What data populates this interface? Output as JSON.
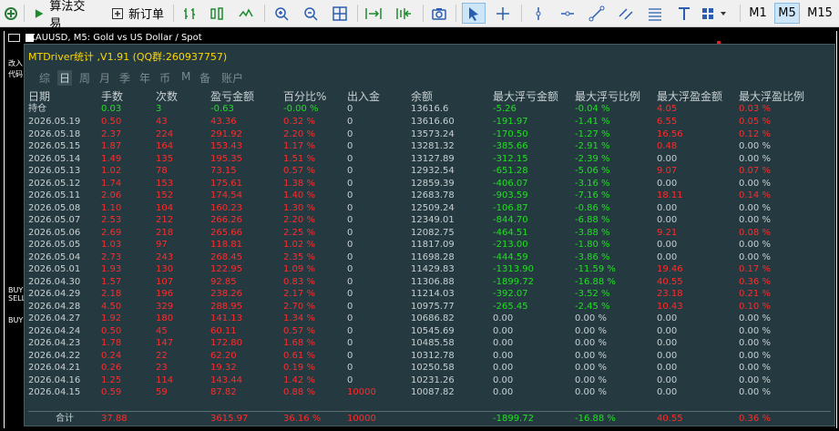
{
  "toolbar": {
    "algo_trading": "算法交易",
    "new_order": "新订单",
    "timeframes": [
      "M1",
      "M5",
      "M15"
    ]
  },
  "chart": {
    "title": "XAUUSD, M5:  Gold vs US Dollar / Spot",
    "side_labels": [
      "改入",
      "代码",
      "BUY",
      "SELL",
      "BUY"
    ]
  },
  "panel": {
    "title": "MTDriver统计 ,V1.91 (QQ群:260937757)",
    "tabs": [
      "综",
      "日",
      "周",
      "月",
      "季",
      "年",
      "币",
      "M",
      "备",
      "账户"
    ],
    "active_tab_index": 1,
    "columns": [
      "日期",
      "手数",
      "次数",
      "盈亏金额",
      "百分比%",
      "出入金",
      "余额",
      "最大浮亏金额",
      "最大浮亏比例",
      "最大浮盈金额",
      "最大浮盈比例"
    ],
    "holding": {
      "label": "持仓",
      "lots": "0.03",
      "count": "3",
      "pnl": "-0.63",
      "pct": "-0.00 %",
      "inout": "0",
      "balance": "13616.6",
      "max_float_loss": "-5.26",
      "max_float_loss_pct": "-0.04 %",
      "max_float_profit": "4.05",
      "max_float_profit_pct": "0.03 %"
    },
    "rows": [
      {
        "date": "2026.05.19",
        "lots": "0.50",
        "count": "43",
        "pnl": "43.36",
        "pct": "0.32 %",
        "inout": "0",
        "balance": "13616.60",
        "mfl": "-191.97",
        "mflp": "-1.41 %",
        "mfp": "6.55",
        "mfpp": "0.05 %"
      },
      {
        "date": "2026.05.18",
        "lots": "2.37",
        "count": "224",
        "pnl": "291.92",
        "pct": "2.20 %",
        "inout": "0",
        "balance": "13573.24",
        "mfl": "-170.50",
        "mflp": "-1.27 %",
        "mfp": "16.56",
        "mfpp": "0.12 %"
      },
      {
        "date": "2026.05.15",
        "lots": "1.87",
        "count": "164",
        "pnl": "153.43",
        "pct": "1.17 %",
        "inout": "0",
        "balance": "13281.32",
        "mfl": "-385.66",
        "mflp": "-2.91 %",
        "mfp": "0.48",
        "mfpp": "0.00 %"
      },
      {
        "date": "2026.05.14",
        "lots": "1.49",
        "count": "135",
        "pnl": "195.35",
        "pct": "1.51 %",
        "inout": "0",
        "balance": "13127.89",
        "mfl": "-312.15",
        "mflp": "-2.39 %",
        "mfp": "0.00",
        "mfpp": "0.00 %"
      },
      {
        "date": "2026.05.13",
        "lots": "1.02",
        "count": "78",
        "pnl": "73.15",
        "pct": "0.57 %",
        "inout": "0",
        "balance": "12932.54",
        "mfl": "-651.28",
        "mflp": "-5.06 %",
        "mfp": "9.07",
        "mfpp": "0.07 %"
      },
      {
        "date": "2026.05.12",
        "lots": "1.74",
        "count": "153",
        "pnl": "175.61",
        "pct": "1.38 %",
        "inout": "0",
        "balance": "12859.39",
        "mfl": "-406.07",
        "mflp": "-3.16 %",
        "mfp": "0.00",
        "mfpp": "0.00 %"
      },
      {
        "date": "2026.05.11",
        "lots": "2.06",
        "count": "152",
        "pnl": "174.54",
        "pct": "1.40 %",
        "inout": "0",
        "balance": "12683.78",
        "mfl": "-903.59",
        "mflp": "-7.16 %",
        "mfp": "18.11",
        "mfpp": "0.14 %"
      },
      {
        "date": "2026.05.08",
        "lots": "1.10",
        "count": "104",
        "pnl": "160.23",
        "pct": "1.30 %",
        "inout": "0",
        "balance": "12509.24",
        "mfl": "-106.87",
        "mflp": "-0.86 %",
        "mfp": "0.00",
        "mfpp": "0.00 %"
      },
      {
        "date": "2026.05.07",
        "lots": "2.53",
        "count": "212",
        "pnl": "266.26",
        "pct": "2.20 %",
        "inout": "0",
        "balance": "12349.01",
        "mfl": "-844.70",
        "mflp": "-6.88 %",
        "mfp": "0.00",
        "mfpp": "0.00 %"
      },
      {
        "date": "2026.05.06",
        "lots": "2.69",
        "count": "218",
        "pnl": "265.66",
        "pct": "2.25 %",
        "inout": "0",
        "balance": "12082.75",
        "mfl": "-464.51",
        "mflp": "-3.88 %",
        "mfp": "9.21",
        "mfpp": "0.08 %"
      },
      {
        "date": "2026.05.05",
        "lots": "1.03",
        "count": "97",
        "pnl": "118.81",
        "pct": "1.02 %",
        "inout": "0",
        "balance": "11817.09",
        "mfl": "-213.00",
        "mflp": "-1.80 %",
        "mfp": "0.00",
        "mfpp": "0.00 %"
      },
      {
        "date": "2026.05.04",
        "lots": "2.73",
        "count": "243",
        "pnl": "268.45",
        "pct": "2.35 %",
        "inout": "0",
        "balance": "11698.28",
        "mfl": "-444.59",
        "mflp": "-3.86 %",
        "mfp": "0.00",
        "mfpp": "0.00 %"
      },
      {
        "date": "2026.05.01",
        "lots": "1.93",
        "count": "130",
        "pnl": "122.95",
        "pct": "1.09 %",
        "inout": "0",
        "balance": "11429.83",
        "mfl": "-1313.90",
        "mflp": "-11.59 %",
        "mfp": "19.46",
        "mfpp": "0.17 %"
      },
      {
        "date": "2026.04.30",
        "lots": "1.57",
        "count": "107",
        "pnl": "92.85",
        "pct": "0.83 %",
        "inout": "0",
        "balance": "11306.88",
        "mfl": "-1899.72",
        "mflp": "-16.88 %",
        "mfp": "40.55",
        "mfpp": "0.36 %"
      },
      {
        "date": "2026.04.29",
        "lots": "2.18",
        "count": "196",
        "pnl": "238.26",
        "pct": "2.17 %",
        "inout": "0",
        "balance": "11214.03",
        "mfl": "-392.07",
        "mflp": "-3.52 %",
        "mfp": "23.18",
        "mfpp": "0.21 %"
      },
      {
        "date": "2026.04.28",
        "lots": "4.50",
        "count": "329",
        "pnl": "288.95",
        "pct": "2.70 %",
        "inout": "0",
        "balance": "10975.77",
        "mfl": "-265.45",
        "mflp": "-2.45 %",
        "mfp": "10.43",
        "mfpp": "0.10 %"
      },
      {
        "date": "2026.04.27",
        "lots": "1.92",
        "count": "180",
        "pnl": "141.13",
        "pct": "1.34 %",
        "inout": "0",
        "balance": "10686.82",
        "mfl": "0.00",
        "mflp": "0.00 %",
        "mfp": "0.00",
        "mfpp": "0.00 %"
      },
      {
        "date": "2026.04.24",
        "lots": "0.50",
        "count": "45",
        "pnl": "60.11",
        "pct": "0.57 %",
        "inout": "0",
        "balance": "10545.69",
        "mfl": "0.00",
        "mflp": "0.00 %",
        "mfp": "0.00",
        "mfpp": "0.00 %"
      },
      {
        "date": "2026.04.23",
        "lots": "1.78",
        "count": "147",
        "pnl": "172.80",
        "pct": "1.68 %",
        "inout": "0",
        "balance": "10485.58",
        "mfl": "0.00",
        "mflp": "0.00 %",
        "mfp": "0.00",
        "mfpp": "0.00 %"
      },
      {
        "date": "2026.04.22",
        "lots": "0.24",
        "count": "22",
        "pnl": "62.20",
        "pct": "0.61 %",
        "inout": "0",
        "balance": "10312.78",
        "mfl": "0.00",
        "mflp": "0.00 %",
        "mfp": "0.00",
        "mfpp": "0.00 %"
      },
      {
        "date": "2026.04.21",
        "lots": "0.26",
        "count": "23",
        "pnl": "19.32",
        "pct": "0.19 %",
        "inout": "0",
        "balance": "10250.58",
        "mfl": "0.00",
        "mflp": "0.00 %",
        "mfp": "0.00",
        "mfpp": "0.00 %"
      },
      {
        "date": "2026.04.16",
        "lots": "1.25",
        "count": "114",
        "pnl": "143.44",
        "pct": "1.42 %",
        "inout": "0",
        "balance": "10231.26",
        "mfl": "0.00",
        "mflp": "0.00 %",
        "mfp": "0.00",
        "mfpp": "0.00 %"
      },
      {
        "date": "2026.04.15",
        "lots": "0.59",
        "count": "59",
        "pnl": "87.82",
        "pct": "0.88 %",
        "inout": "10000",
        "balance": "10087.82",
        "mfl": "0.00",
        "mflp": "0.00 %",
        "mfp": "0.00",
        "mfpp": "0.00 %"
      }
    ],
    "total": {
      "label": "合计",
      "lots": "37.88",
      "count": "",
      "pnl": "3615.97",
      "pct": "36.16 %",
      "inout": "10000",
      "balance": "",
      "mfl": "-1899.72",
      "mflp": "-16.88 %",
      "mfp": "40.55",
      "mfpp": "0.36 %"
    }
  },
  "colors": {
    "panel_bg": "#243a40",
    "profit_red": "#ff2b2b",
    "holding_green": "#20e020",
    "title_yellow": "#ffd700"
  }
}
